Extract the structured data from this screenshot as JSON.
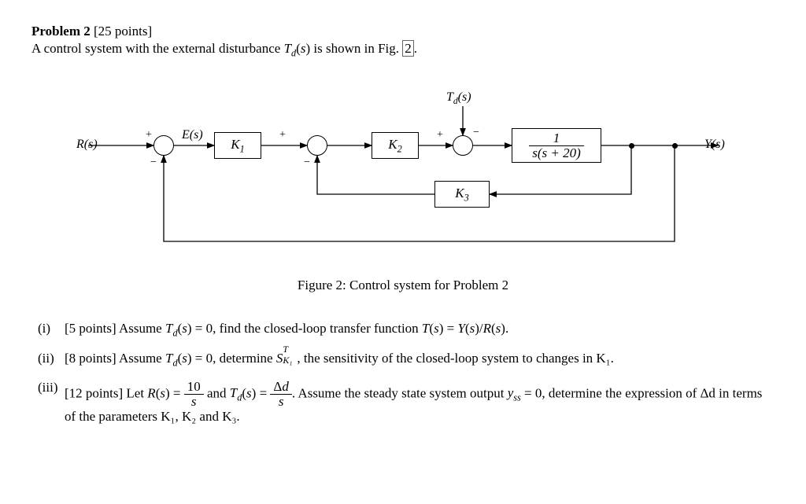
{
  "problem": {
    "title": "Problem 2",
    "points": "[25 points]",
    "intro_pre": "A control system with the external disturbance ",
    "Td": "T_d(s)",
    "intro_post": " is shown in Fig. ",
    "fig_ref": "2",
    "intro_end": "."
  },
  "diagram": {
    "signals": {
      "R": "R(s)",
      "E": "E(s)",
      "Td": "T_d(s)",
      "Y": "Y(s)"
    },
    "blocks": {
      "K1": "K₁",
      "K2": "K₂",
      "K3": "K₃",
      "plant_num": "1",
      "plant_den": "s(s + 20)"
    },
    "signs": {
      "sum1_plus": "+",
      "sum1_minus": "−",
      "sum2_plus": "+",
      "sum2_minus": "−",
      "sum3_plus": "+",
      "sum3_minus": "−"
    }
  },
  "caption": "Figure 2: Control system for Problem 2",
  "parts": {
    "i": {
      "roman": "(i)",
      "pts": "[5 points]",
      "text_a": " Assume ",
      "text_b": " = 0, find the closed-loop transfer function ",
      "text_c": "T(s) = Y(s)/R(s)."
    },
    "ii": {
      "roman": "(ii)",
      "pts": "[8 points]",
      "text_a": " Assume ",
      "text_b": " = 0, determine ",
      "sens": "S",
      "sens_sup": "T",
      "sens_sub": "K₁",
      "text_c": ", the sensitivity of the closed-loop system to changes in K₁."
    },
    "iii": {
      "roman": "(iii)",
      "pts": "[12 points]",
      "text_a": " Let ",
      "R_expr_eq": "R(s) = ",
      "ten": "10",
      "s": "s",
      "and": " and ",
      "Td_eq": "T_d(s) = ",
      "Ad": "Δd",
      "text_b": ". Assume the steady state system output ",
      "yss": "y_ss",
      "text_c": " = 0, determine the expression of Δd in terms of the parameters K₁, K₂ and K₃."
    }
  }
}
